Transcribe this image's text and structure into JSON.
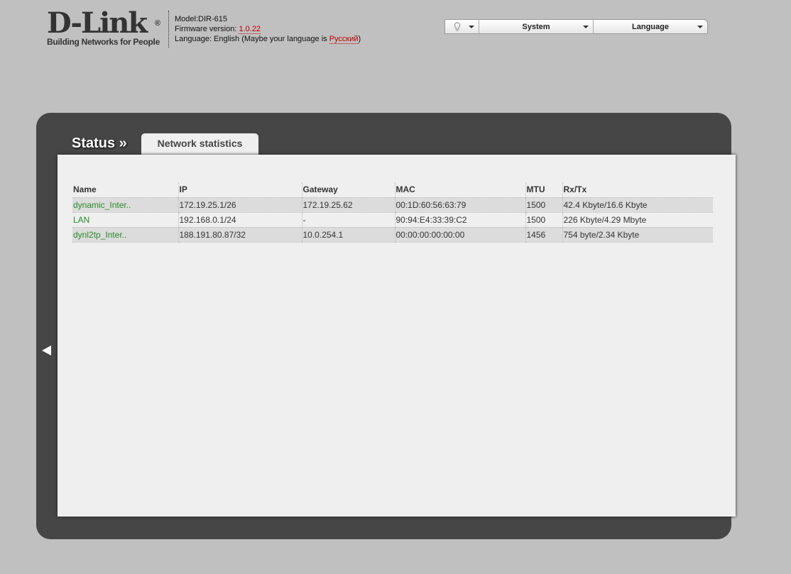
{
  "header": {
    "logo_text": "D-Link",
    "logo_tagline": "Building Networks for People",
    "model_label": "Model:DIR-615",
    "firmware_label": "Firmware version: ",
    "firmware_version": "1.0.22",
    "language_prefix": "Language: English (Maybe your language is ",
    "language_suggest": "Русский",
    "language_suffix": ")"
  },
  "menu": {
    "icon": "lightbulb-icon",
    "system": "System",
    "language": "Language"
  },
  "page": {
    "section": "Status »",
    "tab": "Network statistics"
  },
  "table": {
    "headers": [
      "Name",
      "IP",
      "Gateway",
      "MAC",
      "MTU",
      "Rx/Tx"
    ],
    "rows": [
      [
        "dynamic_Inter..",
        "172.19.25.1/26",
        "172.19.25.62",
        "00:1D:60:56:63:79",
        "1500",
        "42.4 Kbyte/16.6 Kbyte"
      ],
      [
        "LAN",
        "192.168.0.1/24",
        "-",
        "90:94:E4:33:39:C2",
        "1500",
        "226 Kbyte/4.29 Mbyte"
      ],
      [
        "dynl2tp_Inter..",
        "188.191.80.87/32",
        "10.0.254.1",
        "00:00:00:00:00:00",
        "1456",
        "754 byte/2.34 Kbyte"
      ]
    ]
  }
}
